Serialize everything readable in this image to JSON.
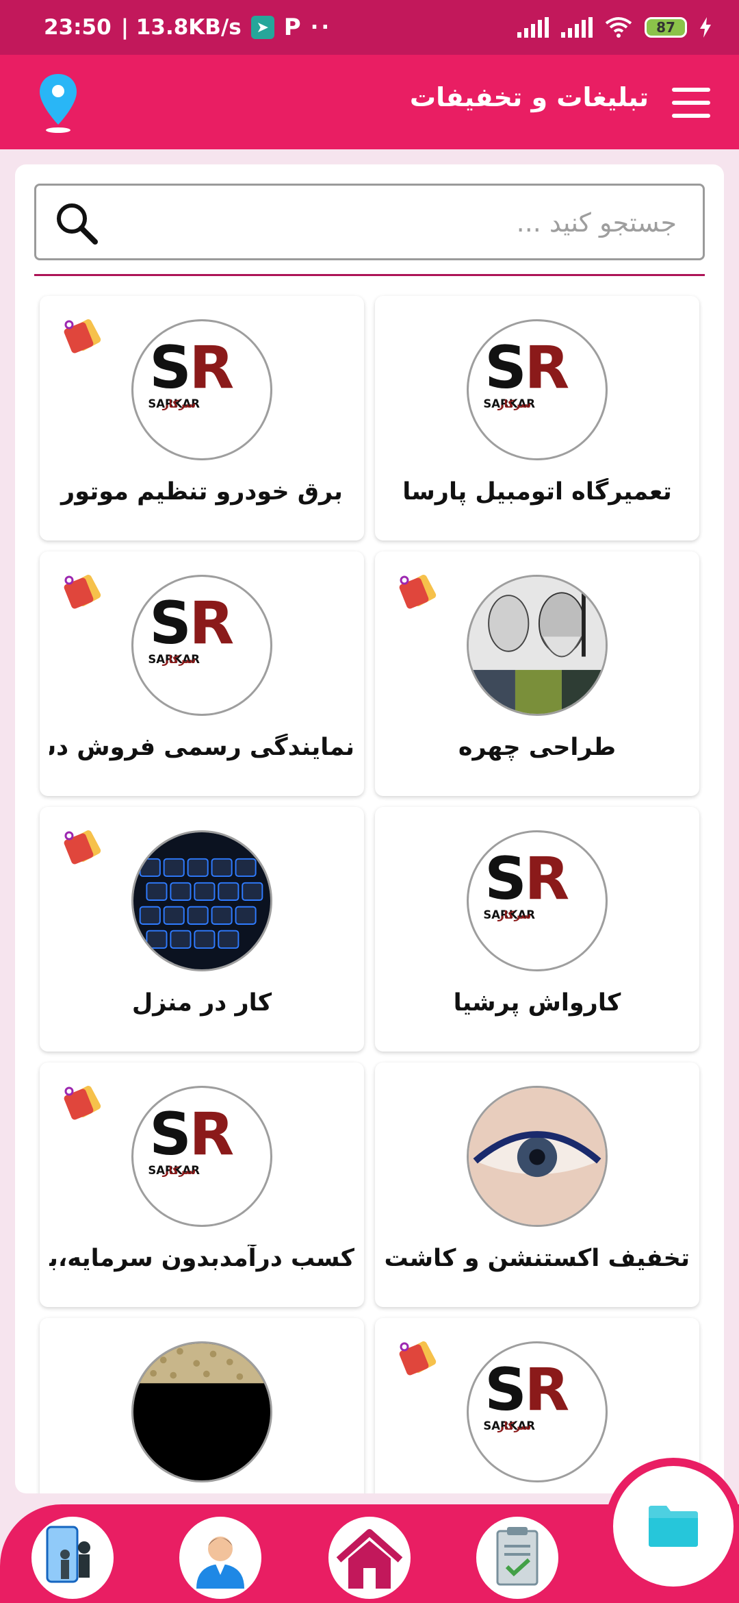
{
  "status_bar": {
    "time": "23:50",
    "network_speed": "| 13.8KB/s",
    "battery": "87",
    "extra": "··"
  },
  "app_bar": {
    "title": "تبلیغات و تخفیفات"
  },
  "search": {
    "placeholder": "جستجو کنید ..."
  },
  "logo_text": {
    "latin": "SARKAR",
    "persian": "سرکار"
  },
  "listings": [
    {
      "title": "تعمیرگاه اتومبیل پارسا",
      "image": "sarkar-logo",
      "discount_tag": false
    },
    {
      "title": "برق خودرو تنظیم موتور",
      "image": "sarkar-logo",
      "discount_tag": true
    },
    {
      "title": "طراحی چهره",
      "image": "portrait-sketches",
      "discount_tag": true
    },
    {
      "title": "نمایندگی رسمی فروش دستگاه ها",
      "image": "sarkar-logo",
      "discount_tag": true
    },
    {
      "title": "کارواش پرشیا",
      "image": "sarkar-logo",
      "discount_tag": false
    },
    {
      "title": "کار در منزل",
      "image": "keyboard-photo",
      "discount_tag": true
    },
    {
      "title": "تخفیف اکستنشن و کاشت مژه",
      "image": "eyelash-photo",
      "discount_tag": false
    },
    {
      "title": "کسب درآمدبدون سرمایه،بدون تجربه",
      "image": "sarkar-logo",
      "discount_tag": true
    },
    {
      "title": "",
      "image": "sarkar-logo",
      "discount_tag": true
    },
    {
      "title": "",
      "image": "grain-photo",
      "discount_tag": false
    }
  ],
  "bottom_nav": [
    "business-meeting-icon",
    "profile-icon",
    "home-icon",
    "checklist-icon",
    "folder-icon"
  ],
  "colors": {
    "primary": "#e91e63",
    "primary_dark": "#c2185b",
    "accent_line": "#ad1457",
    "background": "#f6e4ee"
  }
}
